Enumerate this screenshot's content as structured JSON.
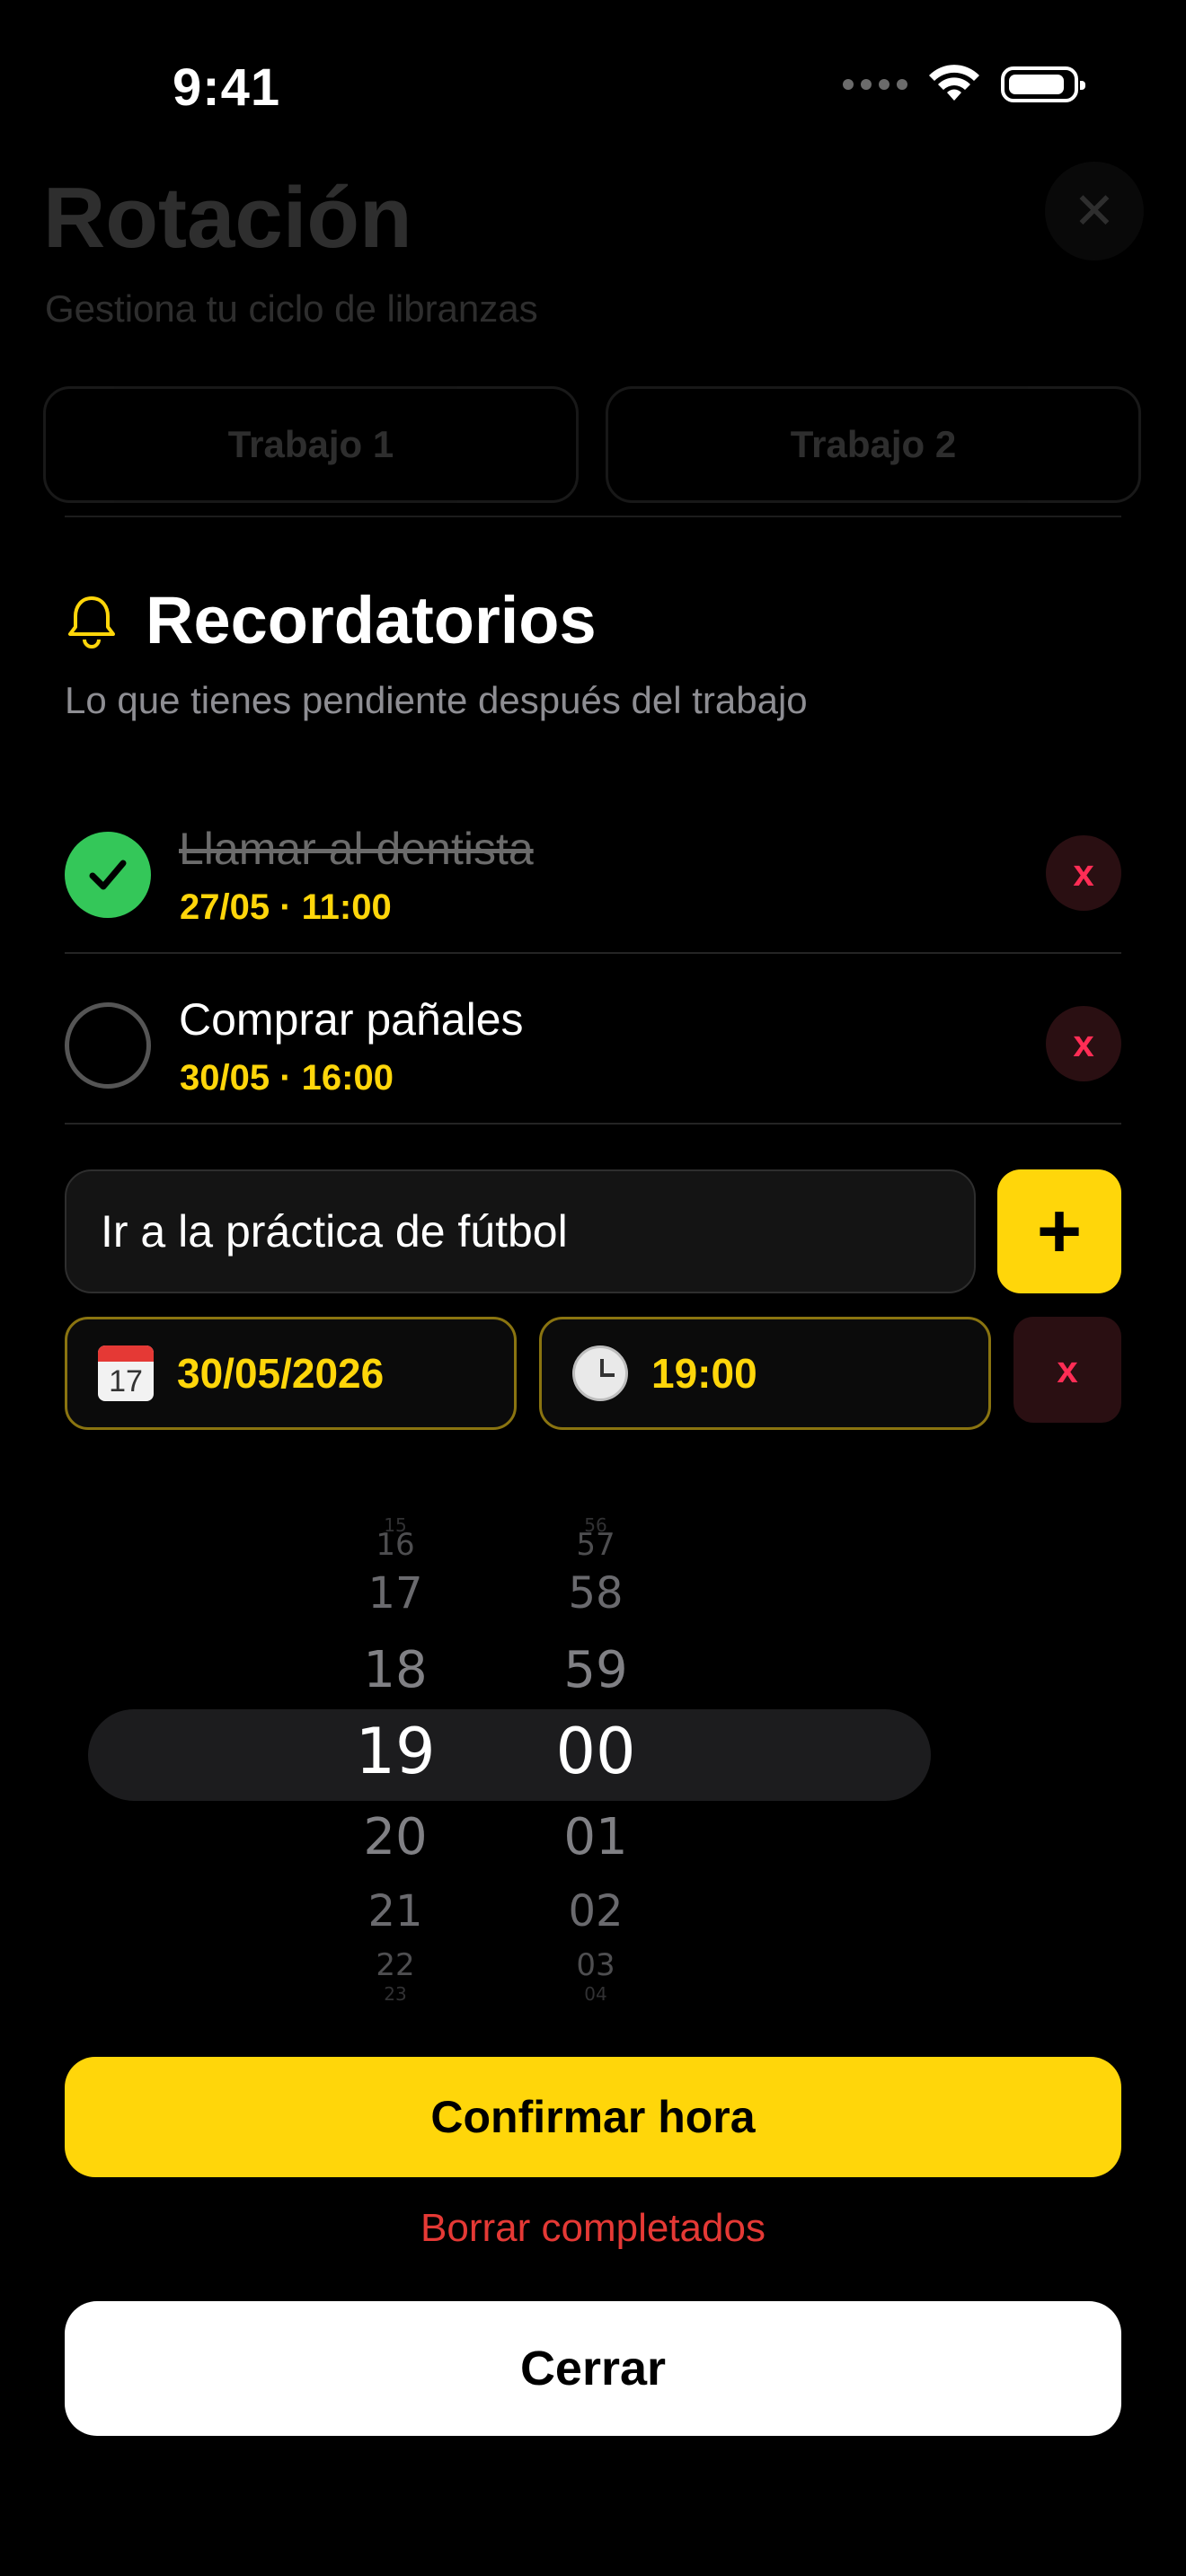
{
  "status_bar": {
    "time": "9:41"
  },
  "background": {
    "title": "Rotación",
    "subtitle": "Gestiona tu ciclo de libranzas",
    "tabs": [
      "Trabajo 1",
      "Trabajo 2"
    ]
  },
  "reminders": {
    "title": "Recordatorios",
    "subtitle": "Lo que tienes pendiente después del trabajo",
    "items": [
      {
        "title": "Llamar al dentista",
        "meta": "27/05 · 11:00",
        "done": true,
        "delete_label": "x"
      },
      {
        "title": "Comprar pañales",
        "meta": "30/05 · 16:00",
        "done": false,
        "delete_label": "x"
      }
    ],
    "new_item": {
      "value": "Ir a la práctica de fútbol",
      "add_label": "+",
      "date": "30/05/2026",
      "time": "19:00",
      "calendar_icon_day": "17",
      "remove_label": "x"
    }
  },
  "picker": {
    "hours": [
      "15",
      "16",
      "17",
      "18",
      "19",
      "20",
      "21",
      "22",
      "23"
    ],
    "minutes": [
      "56",
      "57",
      "58",
      "59",
      "00",
      "01",
      "02",
      "03",
      "04"
    ],
    "selected_hour": "19",
    "selected_minute": "00"
  },
  "actions": {
    "confirm": "Confirmar hora",
    "clear_completed": "Borrar completados",
    "close": "Cerrar"
  },
  "colors": {
    "accent": "#ffd60a",
    "success": "#34c759",
    "danger": "#ff2d55",
    "background": "#000000"
  },
  "icons": {
    "bell": "bell-icon",
    "check": "checkmark-icon",
    "calendar": "calendar-icon",
    "clock": "clock-icon",
    "wifi": "wifi-icon",
    "battery": "battery-icon",
    "close": "close-icon"
  }
}
